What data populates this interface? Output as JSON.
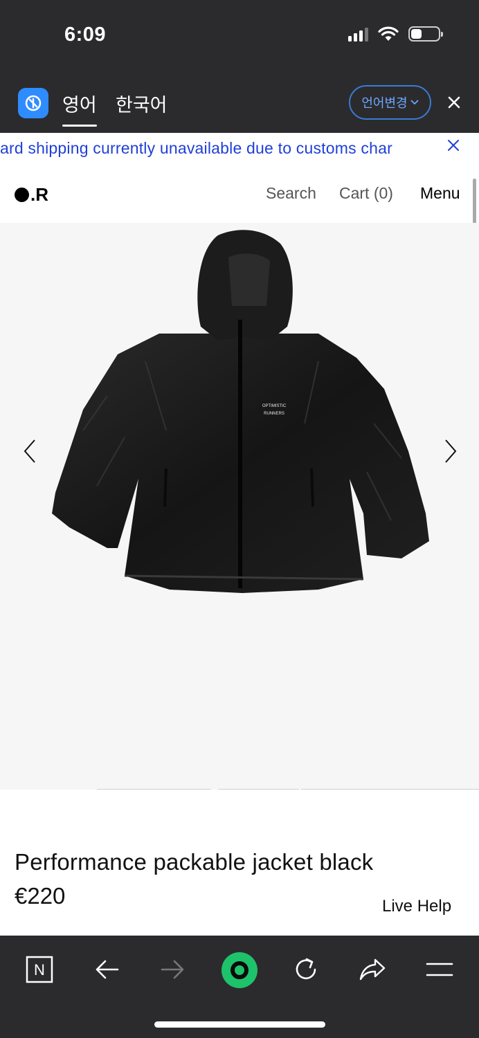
{
  "status_bar": {
    "time": "6:09",
    "icons": [
      "cellular-signal-icon",
      "wifi-icon",
      "battery-icon"
    ]
  },
  "translate_bar": {
    "tabs": [
      {
        "label": "영어",
        "active": true
      },
      {
        "label": "한국어",
        "active": false
      }
    ],
    "change_language_label": "언어변경",
    "close_icon": "close-icon",
    "logo_icon": "translate-logo-icon",
    "accent_color": "#2f8cff"
  },
  "announcement": {
    "text": "ard shipping currently unavailable due to customs char",
    "close_icon": "close-icon",
    "color": "#1f3fd6"
  },
  "site_header": {
    "logo_text": ".R",
    "search_label": "Search",
    "cart_label": "Cart (0)",
    "menu_label": "Menu"
  },
  "gallery": {
    "image_print_line1": "OPTIMISTIC",
    "image_print_line2": "RUNNERS",
    "prev_icon": "chevron-left-icon",
    "next_icon": "chevron-right-icon"
  },
  "product": {
    "title": "Performance packable jacket black",
    "price": "€220",
    "live_help_label": "Live Help"
  },
  "browser_toolbar": {
    "buttons": [
      {
        "name": "tabs-button",
        "icon": "n-square-icon"
      },
      {
        "name": "back-button",
        "icon": "arrow-left-icon"
      },
      {
        "name": "forward-button",
        "icon": "arrow-right-icon"
      },
      {
        "name": "home-button",
        "icon": "green-circle-icon"
      },
      {
        "name": "reload-button",
        "icon": "reload-icon"
      },
      {
        "name": "share-button",
        "icon": "share-icon"
      },
      {
        "name": "menu-button",
        "icon": "hamburger-icon"
      }
    ],
    "home_color": "#1ec26a",
    "label_n": "N"
  }
}
